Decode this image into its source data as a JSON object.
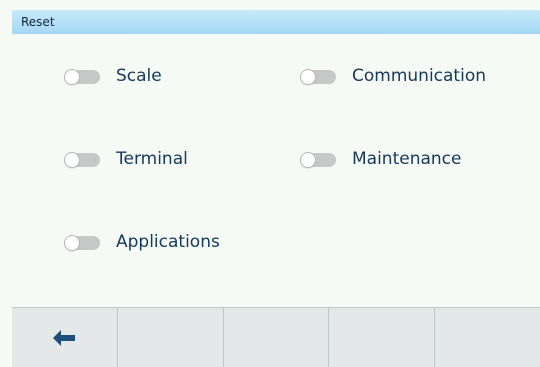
{
  "header": {
    "title": "Reset"
  },
  "toggles": [
    {
      "label": "Scale",
      "checked": false
    },
    {
      "label": "Communication",
      "checked": false
    },
    {
      "label": "Terminal",
      "checked": false
    },
    {
      "label": "Maintenance",
      "checked": false
    },
    {
      "label": "Applications",
      "checked": false
    }
  ],
  "footer": {
    "buttons": [
      {
        "icon": "back-arrow-icon"
      },
      {
        "icon": ""
      },
      {
        "icon": ""
      },
      {
        "icon": ""
      },
      {
        "icon": ""
      }
    ]
  },
  "colors": {
    "title_bar": "#a4d7f4",
    "label_text": "#16385a",
    "toggle_off": "#c6c8c8",
    "back_arrow": "#1d4f7a"
  }
}
